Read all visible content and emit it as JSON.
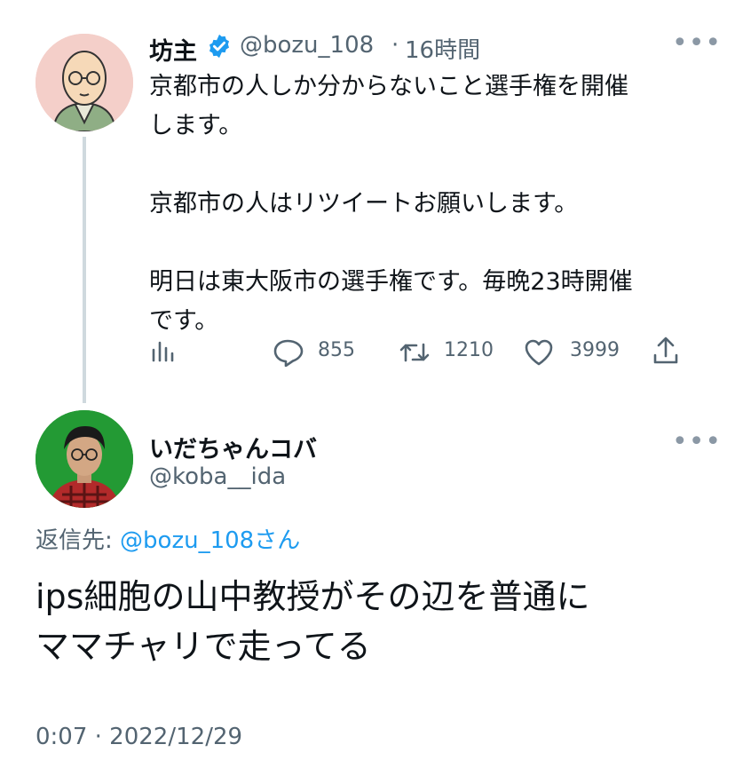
{
  "parent_tweet": {
    "display_name": "坊主",
    "handle": "@bozu_108",
    "dot": "·",
    "time": "16時間",
    "more_label": "•••",
    "text": "京都市の人しか分からないこと選手権を開催\nします。\n\n京都市の人はリツイートお願いします。\n\n明日は東大阪市の選手権です。毎晩23時開催\nです。",
    "replies": "855",
    "retweets": "1210",
    "likes": "3999",
    "icons": {
      "analytics": "analytics-icon",
      "reply": "reply-icon",
      "retweet": "retweet-icon",
      "like": "heart-icon",
      "share": "share-icon",
      "verified": "verified-badge-icon"
    }
  },
  "reply_tweet": {
    "display_name": "いだちゃんコバ",
    "handle": "@koba__ida",
    "more_label": "•••",
    "replying_prefix": "返信先: ",
    "replying_to": "@bozu_108さん",
    "text": "ips細胞の山中教授がその辺を普通に\nママチャリで走ってる",
    "timestamp": "0:07 · 2022/12/29"
  },
  "colors": {
    "text": "#0f1419",
    "muted": "#536471",
    "link": "#1d9bf0",
    "verified": "#1d9bf0",
    "thread_line": "#cfd9de"
  }
}
